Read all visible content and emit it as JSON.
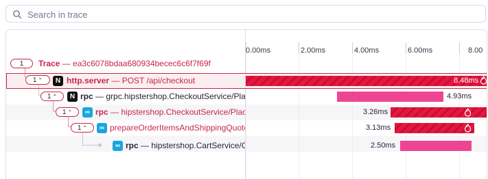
{
  "search": {
    "placeholder": "Search in trace"
  },
  "timeline": {
    "ticks": [
      "0.00ms",
      "2.00ms",
      "4.00ms",
      "6.00ms",
      "8.00"
    ]
  },
  "trace_row": {
    "count": "1",
    "label": "Trace",
    "separator": "—",
    "trace_id": "ea3c6078bdaa680934becec6c6f7f69f"
  },
  "spans": [
    {
      "count": "1",
      "op": "http.server",
      "separator": "—",
      "desc": "POST /api/checkout",
      "duration": "8.48ms",
      "service_icon": "nextjs-icon"
    },
    {
      "count": "1",
      "op": "rpc",
      "separator": "—",
      "desc": "grpc.hipstershop.CheckoutService/PlaceOrder",
      "duration": "4.93ms",
      "service_icon": "nextjs-icon"
    },
    {
      "count": "1",
      "op": "rpc",
      "separator": "—",
      "desc": "hipstershop.CheckoutService/PlaceOrder",
      "duration": "3.26ms",
      "service_icon": "grpc-icon"
    },
    {
      "count": "1",
      "op": "",
      "separator": "",
      "desc": "prepareOrderItemsAndShippingQuoteFromCart",
      "duration": "3.13ms",
      "service_icon": "grpc-icon"
    },
    {
      "count": "",
      "op": "rpc",
      "separator": "—",
      "desc": "hipstershop.CartService/GetCart",
      "duration": "2.50ms",
      "service_icon": "grpc-icon"
    }
  ],
  "colors": {
    "accent": "#c8264a",
    "error_bar": "#e5163f",
    "ok_bar": "#ee4593",
    "grpc": "#1aa5e0"
  }
}
